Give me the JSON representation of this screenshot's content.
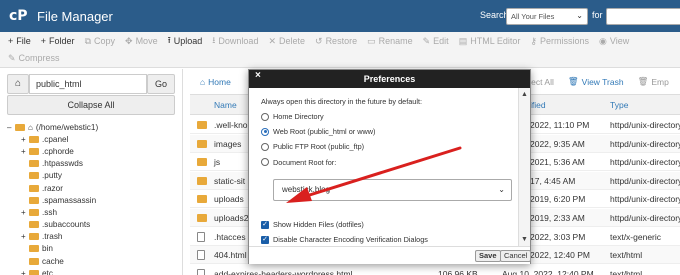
{
  "app": {
    "title": "File Manager",
    "logo": "cP"
  },
  "search": {
    "label": "Search",
    "scope": "All Your Files",
    "for_label": "for",
    "query": ""
  },
  "toolbar": {
    "row1": [
      {
        "label": "File",
        "icon": "+"
      },
      {
        "label": "Folder",
        "icon": "+"
      },
      {
        "label": "Copy",
        "icon": "⧉",
        "disabled": true
      },
      {
        "label": "Move",
        "icon": "✥",
        "disabled": true
      },
      {
        "label": "Upload",
        "icon": "⭱"
      },
      {
        "label": "Download",
        "icon": "⭳",
        "disabled": true
      },
      {
        "label": "Delete",
        "icon": "✕",
        "disabled": true
      },
      {
        "label": "Restore",
        "icon": "↺",
        "disabled": true
      },
      {
        "label": "Rename",
        "icon": "▭",
        "disabled": true
      },
      {
        "label": "Edit",
        "icon": "✎",
        "disabled": true
      },
      {
        "label": "HTML Editor",
        "icon": "▤",
        "disabled": true
      },
      {
        "label": "Permissions",
        "icon": "⚷",
        "disabled": true
      },
      {
        "label": "View",
        "icon": "◉",
        "disabled": true
      }
    ],
    "row2": [
      {
        "label": "Compress",
        "icon": "✎",
        "disabled": true
      }
    ]
  },
  "sidebar": {
    "path_value": "public_html",
    "go_label": "Go",
    "collapse_label": "Collapse All",
    "tree": [
      {
        "label": "(/home/webstic1)",
        "indent": 0,
        "exp": "–",
        "home": true
      },
      {
        "label": ".cpanel",
        "indent": 1,
        "exp": "+"
      },
      {
        "label": ".cphorde",
        "indent": 1,
        "exp": "+"
      },
      {
        "label": ".htpasswds",
        "indent": 1,
        "exp": ""
      },
      {
        "label": ".putty",
        "indent": 1,
        "exp": ""
      },
      {
        "label": ".razor",
        "indent": 1,
        "exp": ""
      },
      {
        "label": ".spamassassin",
        "indent": 1,
        "exp": ""
      },
      {
        "label": ".ssh",
        "indent": 1,
        "exp": "+"
      },
      {
        "label": ".subaccounts",
        "indent": 1,
        "exp": ""
      },
      {
        "label": ".trash",
        "indent": 1,
        "exp": "+"
      },
      {
        "label": "bin",
        "indent": 1,
        "exp": ""
      },
      {
        "label": "cache",
        "indent": 1,
        "exp": ""
      },
      {
        "label": "etc",
        "indent": 1,
        "exp": "+"
      }
    ]
  },
  "main": {
    "actions": [
      {
        "label": "Home",
        "icon": "⌂"
      },
      {
        "label": "Unselect All",
        "icon": "☐",
        "disabled": true
      },
      {
        "label": "View Trash",
        "icon": "🗑"
      },
      {
        "label": "Emp",
        "icon": "🗑",
        "disabled": true
      }
    ],
    "columns": {
      "name": "Name",
      "modified": "ified",
      "type": "Type"
    },
    "rows": [
      {
        "name": ".well-kno",
        "size": "",
        "modified": "2022, 11:10 PM",
        "type": "httpd/unix-directory",
        "kind": "folder"
      },
      {
        "name": "images",
        "size": "",
        "modified": "2022, 9:35 AM",
        "type": "httpd/unix-directory",
        "kind": "folder"
      },
      {
        "name": "js",
        "size": "",
        "modified": "2021, 5:36 AM",
        "type": "httpd/unix-directory",
        "kind": "folder"
      },
      {
        "name": "static-sit",
        "size": "",
        "modified": "17, 4:45 AM",
        "type": "httpd/unix-directory",
        "kind": "folder"
      },
      {
        "name": "uploads",
        "size": "",
        "modified": "2019, 6:20 PM",
        "type": "httpd/unix-directory",
        "kind": "folder"
      },
      {
        "name": "uploads2",
        "size": "",
        "modified": "2019, 2:33 AM",
        "type": "httpd/unix-directory",
        "kind": "folder"
      },
      {
        "name": ".htacces",
        "size": "",
        "modified": "2022, 3:03 PM",
        "type": "text/x-generic",
        "kind": "doc"
      },
      {
        "name": "404.html",
        "size": "",
        "modified": "2022, 12:40 PM",
        "type": "text/html",
        "kind": "doc"
      },
      {
        "name": "add-expires-headers-wordpress.html",
        "size": "106.96 KB",
        "modified": "Aug 10, 2022, 12:40 PM",
        "type": "text/html",
        "kind": "doc"
      }
    ]
  },
  "modal": {
    "title": "Preferences",
    "close": "×",
    "intro": "Always open this directory in the future by default:",
    "options": [
      {
        "label": "Home Directory",
        "selected": false
      },
      {
        "label": "Web Root (public_html or www)",
        "selected": true
      },
      {
        "label": "Public FTP Root (public_ftp)",
        "selected": false
      },
      {
        "label": "Document Root for:",
        "selected": false
      }
    ],
    "domain_value": "webstick.blog",
    "checkboxes": [
      {
        "label": "Show Hidden Files (dotfiles)",
        "checked": true
      },
      {
        "label": "Disable Character Encoding Verification Dialogs",
        "checked": true
      }
    ],
    "save_label": "Save",
    "cancel_label": "Cancel"
  },
  "colors": {
    "header": "#2b5c8a",
    "link": "#337ab7",
    "folder": "#e8a93a",
    "arrow": "#d9201e"
  }
}
